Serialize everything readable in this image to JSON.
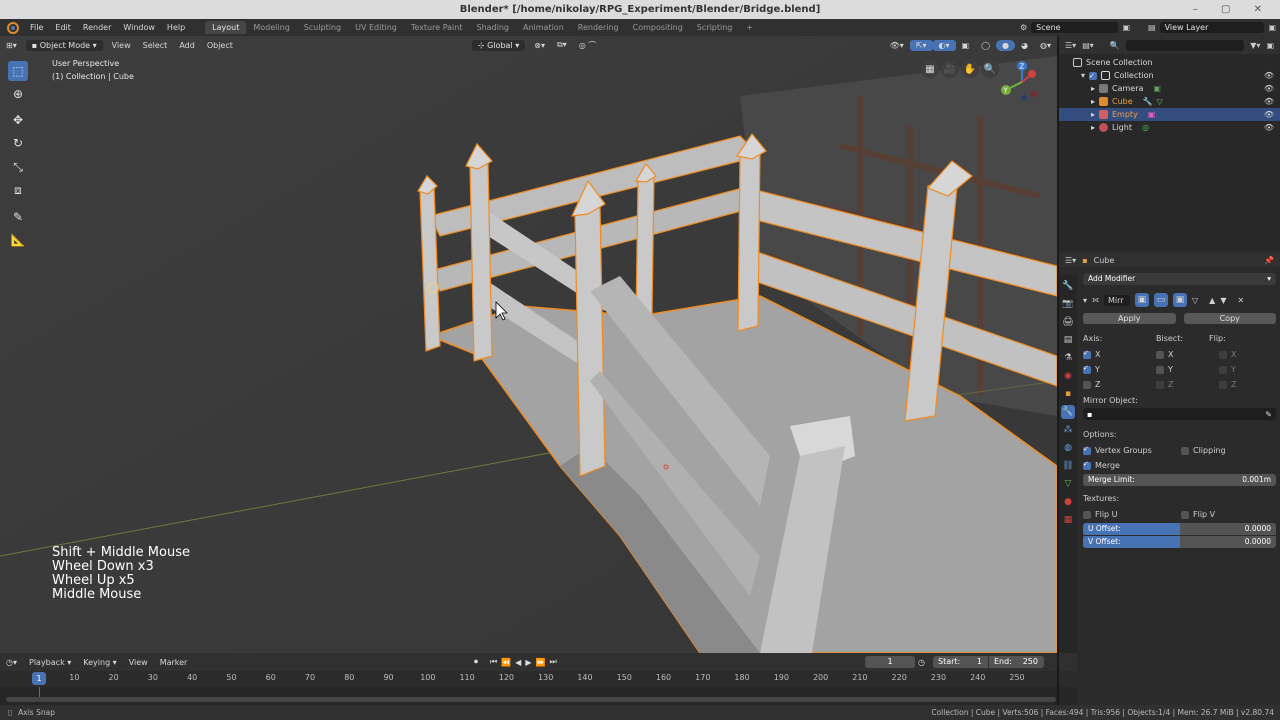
{
  "window": {
    "title": "Blender* [/home/nikolay/RPG_Experiment/Blender/Bridge.blend]"
  },
  "menus": [
    "File",
    "Edit",
    "Render",
    "Window",
    "Help"
  ],
  "workspaces": [
    {
      "label": "Layout",
      "active": true
    },
    {
      "label": "Modeling"
    },
    {
      "label": "Sculpting"
    },
    {
      "label": "UV Editing"
    },
    {
      "label": "Texture Paint"
    },
    {
      "label": "Shading"
    },
    {
      "label": "Animation"
    },
    {
      "label": "Rendering"
    },
    {
      "label": "Compositing"
    },
    {
      "label": "Scripting"
    }
  ],
  "add_workspace": "+",
  "scene": {
    "label": "Scene"
  },
  "view_layer": {
    "label": "View Layer"
  },
  "viewport_header": {
    "mode": "Object Mode",
    "menus": [
      "View",
      "Select",
      "Add",
      "Object"
    ],
    "orientation": "Global"
  },
  "viewport": {
    "perspective": "User Perspective",
    "collection": "(1) Collection | Cube",
    "key_overlay": [
      "Shift + Middle Mouse",
      "Wheel Down x3",
      "Wheel Up x5",
      "Middle Mouse"
    ],
    "gizmo": {
      "x": "X",
      "y": "Y",
      "z": "Z"
    }
  },
  "tools": [
    "select-box",
    "cursor",
    "move",
    "rotate",
    "scale",
    "transform",
    "annotate",
    "measure"
  ],
  "outliner": {
    "root": "Scene Collection",
    "items": [
      {
        "name": "Collection",
        "type": "collection",
        "color": "#cfcfcf"
      },
      {
        "name": "Camera",
        "type": "camera",
        "color": "#d8d8d8"
      },
      {
        "name": "Cube",
        "type": "mesh",
        "color": "#f0a040"
      },
      {
        "name": "Empty",
        "type": "empty",
        "color": "#f0a040",
        "selected": true
      },
      {
        "name": "Light",
        "type": "light",
        "color": "#d8d8d8"
      }
    ]
  },
  "properties": {
    "object_name": "Cube",
    "add_modifier": "Add Modifier",
    "modifier_name": "Mirr",
    "apply": "Apply",
    "copy": "Copy",
    "axis_label": "Axis:",
    "bisect_label": "Bisect:",
    "flip_label": "Flip:",
    "axes": [
      {
        "axis": "X",
        "on": true,
        "bisect": "X",
        "flip": "X"
      },
      {
        "axis": "Y",
        "on": true,
        "bisect": "Y",
        "flip": "Y"
      },
      {
        "axis": "Z",
        "on": false,
        "bisect": "Z",
        "flip": "Z"
      }
    ],
    "mirror_object_label": "Mirror Object:",
    "options_label": "Options:",
    "vertex_groups": "Vertex Groups",
    "clipping": "Clipping",
    "merge": "Merge",
    "merge_limit_label": "Merge Limit:",
    "merge_limit_value": "0.001m",
    "textures_label": "Textures:",
    "flip_u": "Flip U",
    "flip_v": "Flip V",
    "u_offset_label": "U Offset:",
    "u_offset_value": "0.0000",
    "v_offset_label": "V Offset:",
    "v_offset_value": "0.0000"
  },
  "timeline": {
    "menus": [
      "Playback",
      "Keying",
      "View",
      "Marker"
    ],
    "current_frame": "1",
    "start_label": "Start:",
    "start": "1",
    "end_label": "End:",
    "end": "250",
    "ticks": [
      "10",
      "20",
      "30",
      "40",
      "50",
      "60",
      "70",
      "80",
      "90",
      "100",
      "110",
      "120",
      "130",
      "140",
      "150",
      "160",
      "170",
      "180",
      "190",
      "200",
      "210",
      "220",
      "230",
      "240",
      "250"
    ],
    "cursor_frame": "1"
  },
  "status": {
    "left": "Axis Snap",
    "right": "Collection | Cube | Verts:506 | Faces:494 | Tris:956 | Objects:1/4 | Mem: 26.7 MiB | v2.80.74"
  }
}
